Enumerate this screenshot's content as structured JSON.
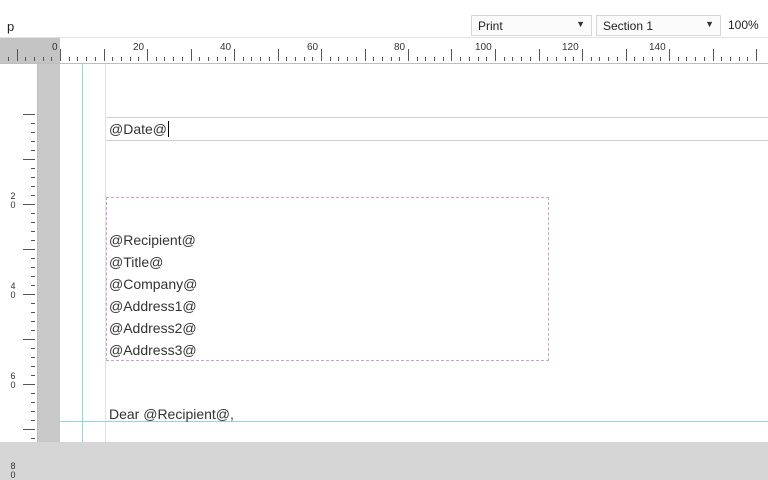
{
  "toolbar": {
    "left_label": "p",
    "view_select": "Print",
    "section_select": "Section 1",
    "zoom": "100%"
  },
  "ruler": {
    "h_labels": [
      "0",
      "20",
      "40",
      "60",
      "80",
      "100",
      "120",
      "140"
    ],
    "v_labels": [
      {
        "top": "2",
        "bottom": "0"
      },
      {
        "top": "4",
        "bottom": "0"
      },
      {
        "top": "6",
        "bottom": "0"
      },
      {
        "top": "8",
        "bottom": "0"
      }
    ]
  },
  "document": {
    "date_field": "@Date@",
    "address_lines": [
      "@Recipient@",
      "@Title@",
      "@Company@",
      "@Address1@",
      "@Address2@",
      "@Address3@"
    ],
    "salutation": "Dear @Recipient@,"
  },
  "colors": {
    "guide": "#8fd8e0",
    "address_box_border": "#d79ad7"
  }
}
